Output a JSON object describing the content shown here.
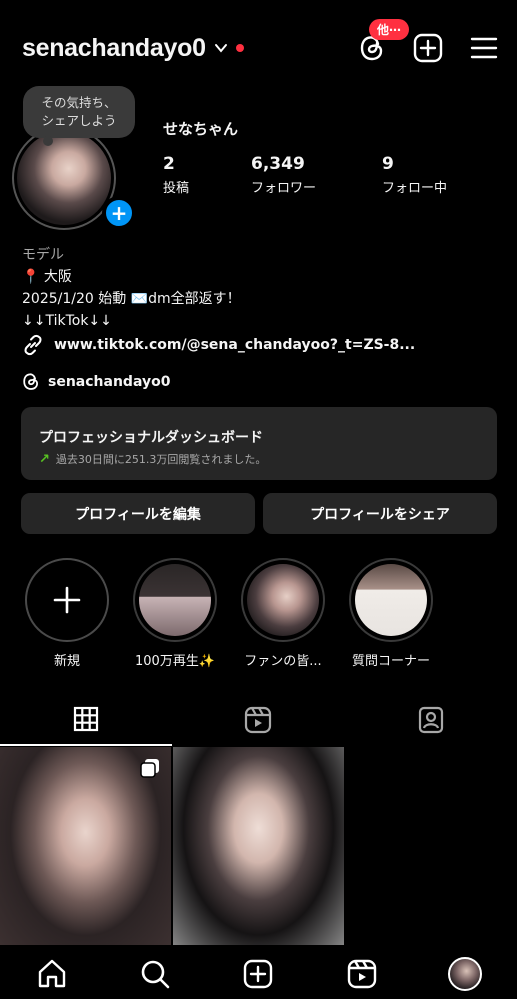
{
  "header": {
    "username": "senachandayo0",
    "threads_badge": "他⋯"
  },
  "profile": {
    "note": "その気持ち、\nシェアしよう",
    "display_name": "せなちゃん",
    "stats": [
      {
        "num": "2",
        "label": "投稿"
      },
      {
        "num": "6,349",
        "label": "フォロワー"
      },
      {
        "num": "9",
        "label": "フォロー中"
      }
    ],
    "category": "モデル",
    "bio_lines": [
      "📍 大阪",
      "2025/1/20 始動 ✉️dm全部返す！",
      "↓↓TikTok↓↓"
    ],
    "link": "www.tiktok.com/@sena_chandayoo?_t=ZS-8...",
    "threads_handle": "senachandayo0"
  },
  "dashboard": {
    "title": "プロフェッショナルダッシュボード",
    "subtitle": "過去30日間に251.3万回閲覧されました。"
  },
  "buttons": {
    "edit": "プロフィールを編集",
    "share": "プロフィールをシェア"
  },
  "highlights": [
    {
      "label": "新規"
    },
    {
      "label": "100万再生✨"
    },
    {
      "label": "ファンの皆..."
    },
    {
      "label": "質問コーナー"
    }
  ],
  "colors": {
    "accent_blue": "#0095f6",
    "notification_red": "#ff3040",
    "surface": "#262626",
    "growth_green": "#58c322"
  }
}
